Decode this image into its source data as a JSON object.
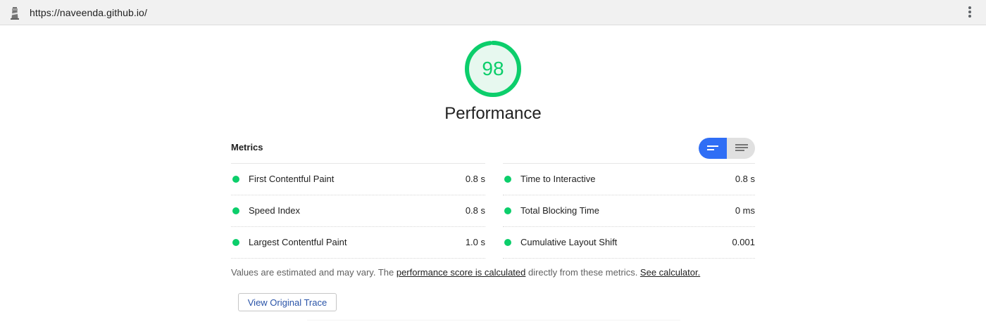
{
  "browser": {
    "url": "https://naveenda.github.io/",
    "icons": {
      "site": "lighthouse-icon",
      "menu": "more-vertical-icon"
    }
  },
  "gauge": {
    "score": "98",
    "score_fraction": 0.98,
    "title": "Performance",
    "color": "#0cce6b"
  },
  "metrics": {
    "header": "Metrics",
    "toggle": {
      "options": [
        "compact-view-icon",
        "expanded-view-icon"
      ],
      "selected": "compact-view-icon",
      "active_color": "#2f6ef5"
    },
    "left": [
      {
        "name": "First Contentful Paint",
        "value": "0.8 s"
      },
      {
        "name": "Speed Index",
        "value": "0.8 s"
      },
      {
        "name": "Largest Contentful Paint",
        "value": "1.0 s"
      }
    ],
    "right": [
      {
        "name": "Time to Interactive",
        "value": "0.8 s"
      },
      {
        "name": "Total Blocking Time",
        "value": "0 ms"
      },
      {
        "name": "Cumulative Layout Shift",
        "value": "0.001"
      }
    ],
    "status_color": "#0cce6b"
  },
  "footer": {
    "note_prefix": "Values are estimated and may vary. The ",
    "note_link1": "performance score is calculated",
    "note_middle": " directly from these metrics. ",
    "note_link2": "See calculator.",
    "trace_button": "View Original Trace"
  }
}
